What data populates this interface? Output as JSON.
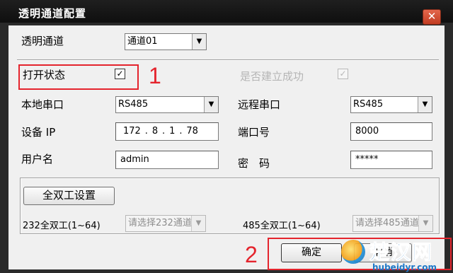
{
  "window": {
    "title": "透明通道配置",
    "close_glyph": "✕"
  },
  "channel": {
    "label": "透明通道",
    "value": "通道01"
  },
  "status": {
    "open_label": "打开状态",
    "open_checked": true,
    "established_label": "是否建立成功",
    "established_checked": true
  },
  "local_port": {
    "label": "本地串口",
    "value": "RS485"
  },
  "remote_port": {
    "label": "远程串口",
    "value": "RS485"
  },
  "device_ip": {
    "label": "设备 IP",
    "octets": [
      "172",
      "8",
      "1",
      "78"
    ]
  },
  "port": {
    "label": "端口号",
    "value": "8000"
  },
  "username": {
    "label": "用户名",
    "value": "admin"
  },
  "password": {
    "label": "密　码",
    "value": "*****"
  },
  "duplex": {
    "button_label": "全双工设置",
    "ch232_label": "232全双工(1~64)",
    "ch232_placeholder": "请选择232通道",
    "ch485_label": "485全双工(1~64)",
    "ch485_placeholder": "请选择485通道"
  },
  "buttons": {
    "ok": "确定",
    "cancel": "取消"
  },
  "annotations": {
    "marker1": "1",
    "marker2": "2",
    "color": "#e4242d"
  },
  "watermark": {
    "text": "楚汉网",
    "url": "hubeidyr.com"
  },
  "icons": {
    "dropdown": "triangle-down-icon",
    "check": "check-icon",
    "close": "close-icon"
  }
}
